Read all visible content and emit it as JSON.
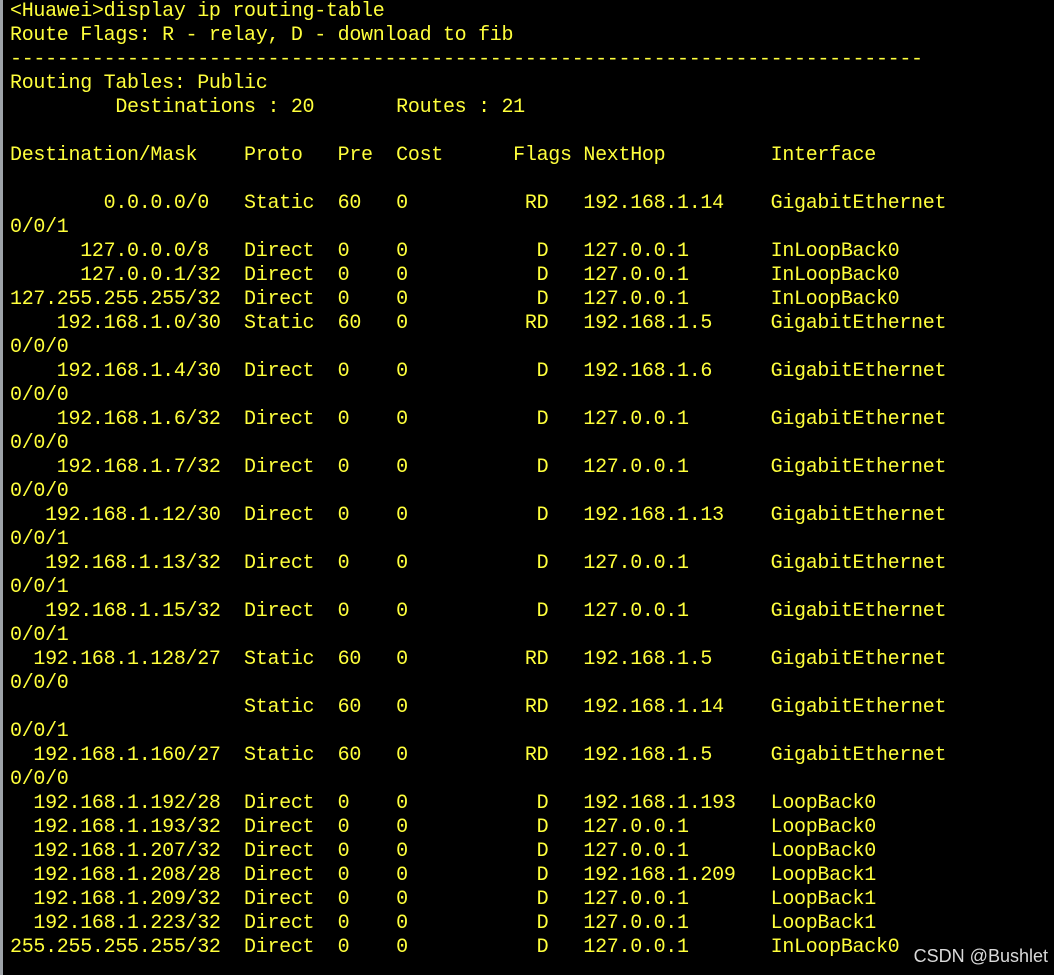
{
  "console": {
    "lines": [
      "<Huawei>display ip routing-table",
      "Route Flags: R - relay, D - download to fib",
      "------------------------------------------------------------------------------",
      "Routing Tables: Public",
      "         Destinations : 20       Routes : 21",
      "",
      "Destination/Mask    Proto   Pre  Cost      Flags NextHop         Interface",
      "",
      "        0.0.0.0/0   Static  60   0          RD   192.168.1.14    GigabitEthernet",
      "0/0/1",
      "      127.0.0.0/8   Direct  0    0           D   127.0.0.1       InLoopBack0",
      "      127.0.0.1/32  Direct  0    0           D   127.0.0.1       InLoopBack0",
      "127.255.255.255/32  Direct  0    0           D   127.0.0.1       InLoopBack0",
      "    192.168.1.0/30  Static  60   0          RD   192.168.1.5     GigabitEthernet",
      "0/0/0",
      "    192.168.1.4/30  Direct  0    0           D   192.168.1.6     GigabitEthernet",
      "0/0/0",
      "    192.168.1.6/32  Direct  0    0           D   127.0.0.1       GigabitEthernet",
      "0/0/0",
      "    192.168.1.7/32  Direct  0    0           D   127.0.0.1       GigabitEthernet",
      "0/0/0",
      "   192.168.1.12/30  Direct  0    0           D   192.168.1.13    GigabitEthernet",
      "0/0/1",
      "   192.168.1.13/32  Direct  0    0           D   127.0.0.1       GigabitEthernet",
      "0/0/1",
      "   192.168.1.15/32  Direct  0    0           D   127.0.0.1       GigabitEthernet",
      "0/0/1",
      "  192.168.1.128/27  Static  60   0          RD   192.168.1.5     GigabitEthernet",
      "0/0/0",
      "                    Static  60   0          RD   192.168.1.14    GigabitEthernet",
      "0/0/1",
      "  192.168.1.160/27  Static  60   0          RD   192.168.1.5     GigabitEthernet",
      "0/0/0",
      "  192.168.1.192/28  Direct  0    0           D   192.168.1.193   LoopBack0",
      "  192.168.1.193/32  Direct  0    0           D   127.0.0.1       LoopBack0",
      "  192.168.1.207/32  Direct  0    0           D   127.0.0.1       LoopBack0",
      "  192.168.1.208/28  Direct  0    0           D   192.168.1.209   LoopBack1",
      "  192.168.1.209/32  Direct  0    0           D   127.0.0.1       LoopBack1",
      "  192.168.1.223/32  Direct  0    0           D   127.0.0.1       LoopBack1",
      "255.255.255.255/32  Direct  0    0           D   127.0.0.1       InLoopBack0"
    ]
  },
  "watermark": "CSDN @Bushlet",
  "colors": {
    "background": "#000000",
    "text": "#ffff3c",
    "border": "#9ea3a8"
  }
}
